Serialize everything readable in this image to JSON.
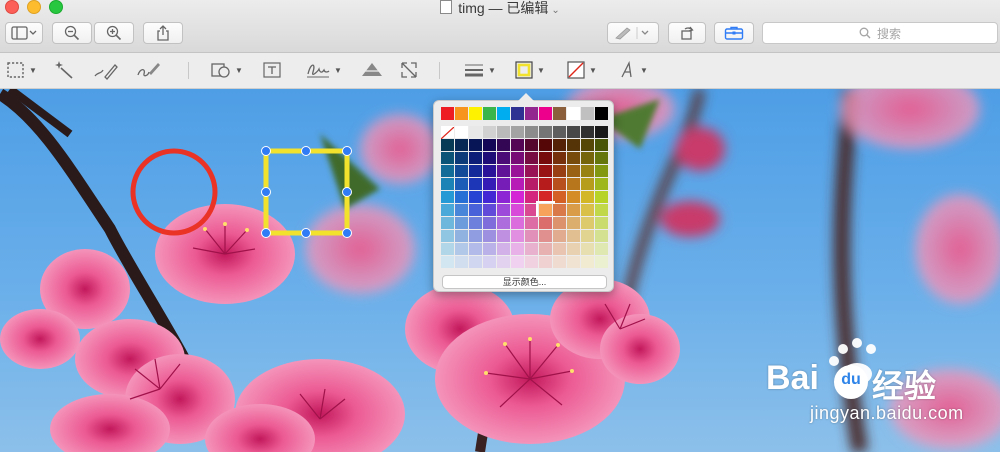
{
  "window": {
    "filename": "timg",
    "separator": "—",
    "status": "已编辑"
  },
  "toolbar": {
    "search_placeholder": "搜索"
  },
  "color_popover": {
    "show_colors_label": "显示颜色...",
    "top_swatches": [
      "#ee1d23",
      "#f7941d",
      "#fff200",
      "#39b54a",
      "#00aeef",
      "#2e3192",
      "#92278f",
      "#ec008c",
      "#8b5e3c",
      "#ffffff",
      "#c0c0c0",
      "#000000"
    ],
    "selected_color": "#f7a35c"
  },
  "annotations": {
    "circle_color": "#ea3325",
    "rect_color": "#f2e22e"
  },
  "watermark": {
    "brand_latin": "Bai",
    "brand_cn": "经验",
    "url": "jingyan.baidu.com"
  }
}
